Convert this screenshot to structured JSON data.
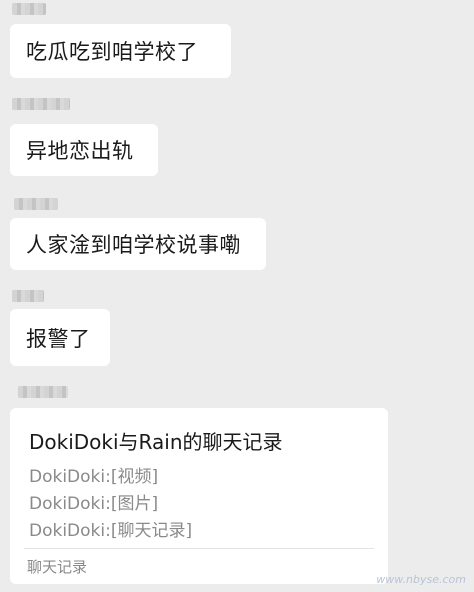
{
  "messages": [
    {
      "text": "吃瓜吃到咱学校了"
    },
    {
      "text": "异地恋出轨"
    },
    {
      "text": "人家淦到咱学校说事嘞"
    },
    {
      "text": "报警了"
    }
  ],
  "chat_record_card": {
    "title": "DokiDoki与Rain的聊天记录",
    "lines": [
      "DokiDoki:[视频]",
      "DokiDoki:[图片]",
      "DokiDoki:[聊天记录]"
    ],
    "footer": "聊天记录"
  },
  "watermark": "www.nbyse.com"
}
